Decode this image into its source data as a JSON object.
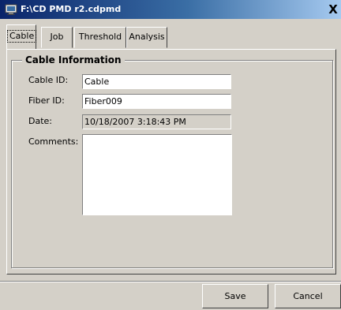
{
  "window": {
    "title": "F:\\CD PMD r2.cdpmd",
    "close_label": "X"
  },
  "tabs": [
    {
      "label": "Cable"
    },
    {
      "label": "Job"
    },
    {
      "label": "Threshold"
    },
    {
      "label": "Analysis"
    }
  ],
  "group": {
    "title": "Cable Information"
  },
  "fields": {
    "cable_id": {
      "label": "Cable ID:",
      "value": "Cable"
    },
    "fiber_id": {
      "label": "Fiber ID:",
      "value": "Fiber009"
    },
    "date": {
      "label": "Date:",
      "value": "10/18/2007 3:18:43 PM"
    },
    "comments": {
      "label": "Comments:",
      "value": ""
    }
  },
  "buttons": {
    "save_label": "Save",
    "cancel_label": "Cancel"
  }
}
